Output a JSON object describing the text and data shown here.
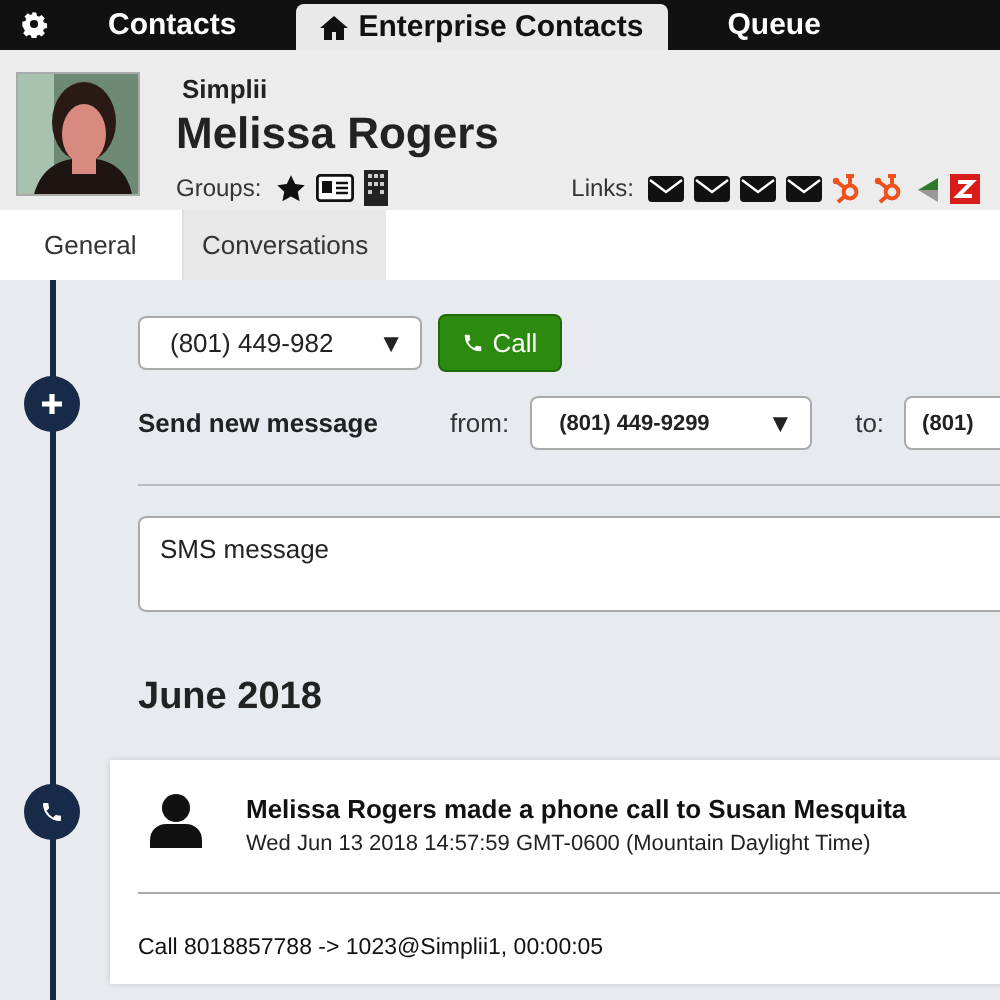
{
  "nav": {
    "tabs": [
      {
        "label": "Contacts",
        "selected": false,
        "kind": "plain"
      },
      {
        "label": "Enterprise Contacts",
        "selected": true,
        "kind": "home"
      },
      {
        "label": "Queue",
        "selected": false,
        "kind": "plain"
      }
    ]
  },
  "contact": {
    "company": "Simplii",
    "name": "Melissa Rogers",
    "groups_label": "Groups:",
    "groups": [
      {
        "kind": "star"
      },
      {
        "kind": "card"
      },
      {
        "kind": "building"
      }
    ],
    "links_label": "Links:",
    "links": [
      {
        "kind": "mail"
      },
      {
        "kind": "mail"
      },
      {
        "kind": "mail"
      },
      {
        "kind": "mail"
      },
      {
        "kind": "hubspot"
      },
      {
        "kind": "hubspot"
      },
      {
        "kind": "green"
      },
      {
        "kind": "zendesk"
      }
    ]
  },
  "tabs": [
    {
      "label": "General",
      "selected": false
    },
    {
      "label": "Conversations",
      "selected": true
    }
  ],
  "call_row": {
    "number": "(801) 449-982",
    "caret": "▼",
    "button": "Call"
  },
  "message_row": {
    "label": "Send new message",
    "from_label": "from:",
    "from": "(801) 449-9299",
    "from_caret": "▼",
    "to_label": "to:",
    "to": "(801)"
  },
  "sms": {
    "placeholder": "SMS message"
  },
  "month": "June 2018",
  "events": [
    {
      "title": "Melissa Rogers made a phone call to Susan Mesquita",
      "date": "Wed Jun 13 2018 14:57:59 GMT-0600 (Mountain Daylight Time)",
      "detail": "Call 8018857788 -> 1023@Simplii1, 00:00:05"
    }
  ]
}
